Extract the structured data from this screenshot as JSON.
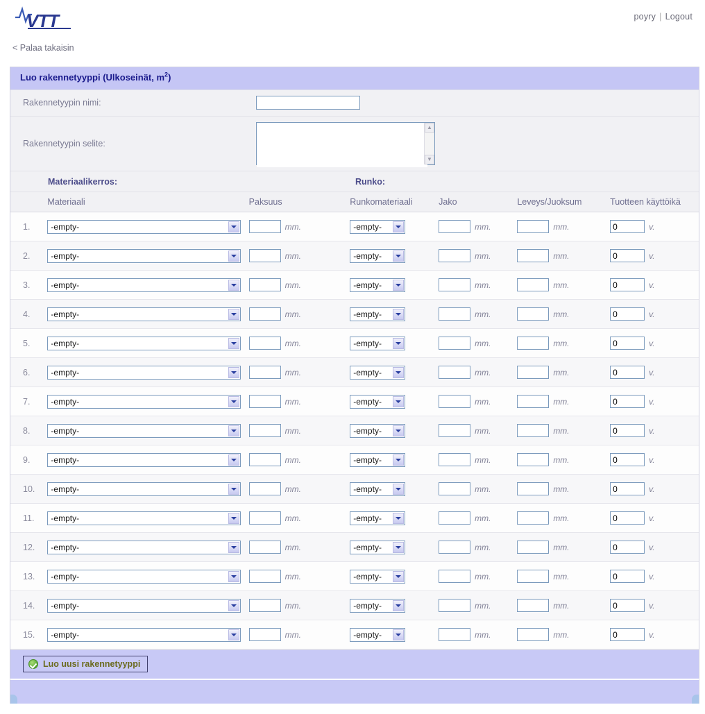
{
  "header": {
    "logo_text": "VTT",
    "user_name": "poyry",
    "separator": "|",
    "logout_label": "Logout"
  },
  "back_link": {
    "label": "< Palaa takaisin"
  },
  "panel": {
    "title_main": "Luo rakennetyyppi (Ulkoseinät, m",
    "title_sup": "2",
    "title_close": ")"
  },
  "form": {
    "name_label": "Rakennetyypin nimi:",
    "name_value": "",
    "desc_label": "Rakennetyypin selite:",
    "desc_value": "",
    "scroll_up": "▲",
    "scroll_down": "▼"
  },
  "groups": {
    "layer_label": "Materiaalikerros:",
    "frame_label": "Runko:"
  },
  "columns": {
    "material": "Materiaali",
    "thickness": "Paksuus",
    "frame_material": "Runkomateriaali",
    "spacing": "Jako",
    "width": "Leveys/Juoksum",
    "lifetime": "Tuotteen käyttöikä"
  },
  "units": {
    "mm": "mm.",
    "years": "v."
  },
  "select_placeholder": "-empty-",
  "rows": [
    {
      "index": "1.",
      "material": "-empty-",
      "thickness": "",
      "frame_material": "-empty-",
      "spacing": "",
      "width": "",
      "lifetime": "0"
    },
    {
      "index": "2.",
      "material": "-empty-",
      "thickness": "",
      "frame_material": "-empty-",
      "spacing": "",
      "width": "",
      "lifetime": "0"
    },
    {
      "index": "3.",
      "material": "-empty-",
      "thickness": "",
      "frame_material": "-empty-",
      "spacing": "",
      "width": "",
      "lifetime": "0"
    },
    {
      "index": "4.",
      "material": "-empty-",
      "thickness": "",
      "frame_material": "-empty-",
      "spacing": "",
      "width": "",
      "lifetime": "0"
    },
    {
      "index": "5.",
      "material": "-empty-",
      "thickness": "",
      "frame_material": "-empty-",
      "spacing": "",
      "width": "",
      "lifetime": "0"
    },
    {
      "index": "6.",
      "material": "-empty-",
      "thickness": "",
      "frame_material": "-empty-",
      "spacing": "",
      "width": "",
      "lifetime": "0"
    },
    {
      "index": "7.",
      "material": "-empty-",
      "thickness": "",
      "frame_material": "-empty-",
      "spacing": "",
      "width": "",
      "lifetime": "0"
    },
    {
      "index": "8.",
      "material": "-empty-",
      "thickness": "",
      "frame_material": "-empty-",
      "spacing": "",
      "width": "",
      "lifetime": "0"
    },
    {
      "index": "9.",
      "material": "-empty-",
      "thickness": "",
      "frame_material": "-empty-",
      "spacing": "",
      "width": "",
      "lifetime": "0"
    },
    {
      "index": "10.",
      "material": "-empty-",
      "thickness": "",
      "frame_material": "-empty-",
      "spacing": "",
      "width": "",
      "lifetime": "0"
    },
    {
      "index": "11.",
      "material": "-empty-",
      "thickness": "",
      "frame_material": "-empty-",
      "spacing": "",
      "width": "",
      "lifetime": "0"
    },
    {
      "index": "12.",
      "material": "-empty-",
      "thickness": "",
      "frame_material": "-empty-",
      "spacing": "",
      "width": "",
      "lifetime": "0"
    },
    {
      "index": "13.",
      "material": "-empty-",
      "thickness": "",
      "frame_material": "-empty-",
      "spacing": "",
      "width": "",
      "lifetime": "0"
    },
    {
      "index": "14.",
      "material": "-empty-",
      "thickness": "",
      "frame_material": "-empty-",
      "spacing": "",
      "width": "",
      "lifetime": "0"
    },
    {
      "index": "15.",
      "material": "-empty-",
      "thickness": "",
      "frame_material": "-empty-",
      "spacing": "",
      "width": "",
      "lifetime": "0"
    }
  ],
  "action": {
    "create_label": "Luo uusi rakennetyyppi",
    "icon": "check-circle-icon"
  },
  "colors": {
    "panel_header_bg": "#c5c6f5",
    "panel_header_text": "#1a1a8c",
    "input_border": "#7c9bbd",
    "button_text": "#6b6b1f",
    "ok_green": "#57a832",
    "logo_navy": "#2b3990"
  }
}
